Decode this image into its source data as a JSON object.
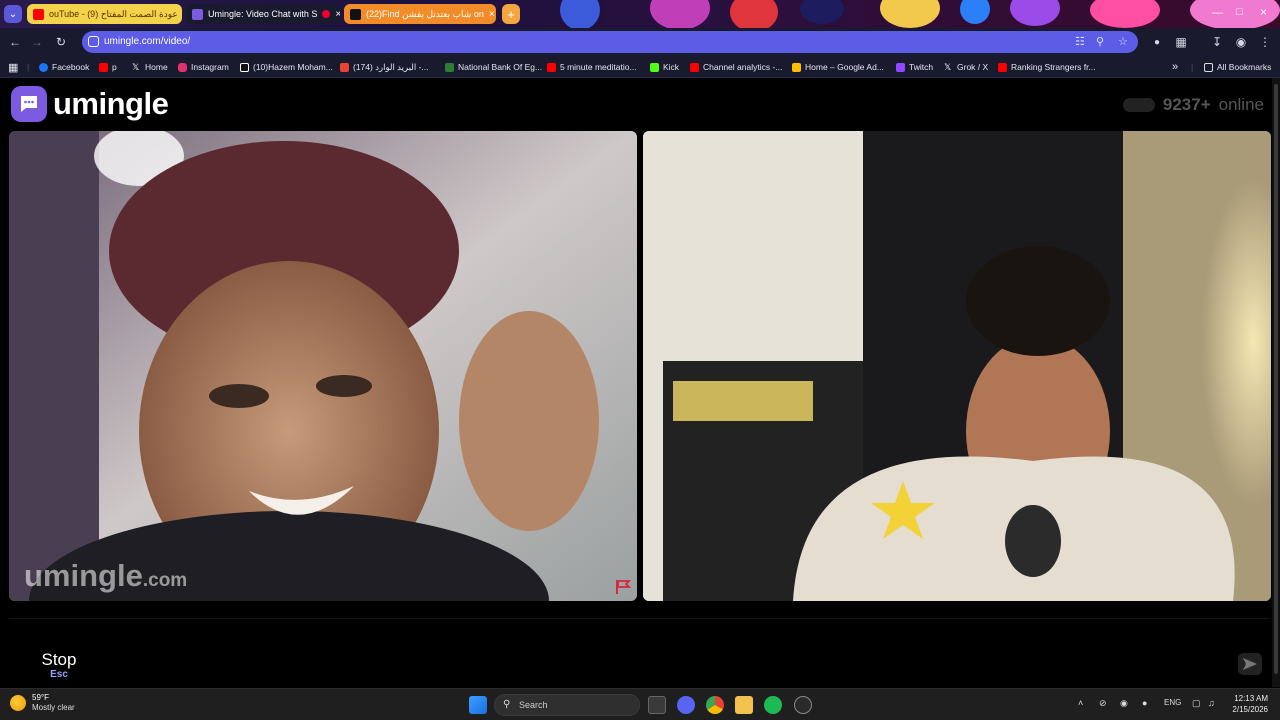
{
  "browser": {
    "tabs": [
      {
        "label": "ouTube - (9) عودة الصمت المفتاح",
        "color": "#f2d34a",
        "icon": "youtube-icon",
        "active": false
      },
      {
        "label": "Umingle: Video Chat with S",
        "color": "#1a1a2e",
        "icon": "umingle-icon",
        "active": true
      },
      {
        "label": "(22)Find شاب بعتدتل يفشن on",
        "color": "#f28c28",
        "icon": "tiktok-icon",
        "active": false
      }
    ],
    "new_tab": "+",
    "url": "umingle.com/video/",
    "bookmarks": [
      {
        "label": "Facebook",
        "icon": "facebook-icon",
        "color": "#1877f2"
      },
      {
        "label": "p",
        "icon": "youtube-icon",
        "color": "#ff0000"
      },
      {
        "label": "Home",
        "icon": "x-icon",
        "color": "#ffffff"
      },
      {
        "label": "Instagram",
        "icon": "instagram-icon",
        "color": "#e1306c"
      },
      {
        "label": "(10)Hazem Moham...",
        "icon": "tiktok-icon",
        "color": "#ffffff"
      },
      {
        "label": "(174) البريد الوارد -...",
        "icon": "gmail-icon",
        "color": "#ea4335"
      },
      {
        "label": "National Bank Of Eg...",
        "icon": "bank-icon",
        "color": "#2e7d32"
      },
      {
        "label": "5 minute meditatio...",
        "icon": "youtube-icon",
        "color": "#ff0000"
      },
      {
        "label": "Kick",
        "icon": "kick-icon",
        "color": "#53fc18"
      },
      {
        "label": "Channel analytics -...",
        "icon": "youtube-icon",
        "color": "#ff0000"
      },
      {
        "label": "Home – Google Ad...",
        "icon": "google-ads-icon",
        "color": "#fbbc04"
      },
      {
        "label": "Twitch",
        "icon": "twitch-icon",
        "color": "#9146ff"
      },
      {
        "label": "Grok / X",
        "icon": "x-icon",
        "color": "#ffffff"
      },
      {
        "label": "Ranking Strangers fr...",
        "icon": "youtube-icon",
        "color": "#ff0000"
      }
    ],
    "all_bookmarks": "All Bookmarks"
  },
  "page": {
    "logo_text": "umingle",
    "online_count": "9237+",
    "online_label": "online",
    "watermark_main": "umingle",
    "watermark_domain": ".com",
    "stop_label": "Stop",
    "stop_shortcut": "Esc"
  },
  "taskbar": {
    "weather_temp": "59°F",
    "weather_desc": "Mostly clear",
    "search_label": "Search",
    "lang": "ENG",
    "time": "12:13 AM",
    "date": "2/15/2026"
  },
  "colors": {
    "accent": "#5c5ce6",
    "logo_badge": "#7c5be0",
    "flag_red": "#d7263d"
  }
}
